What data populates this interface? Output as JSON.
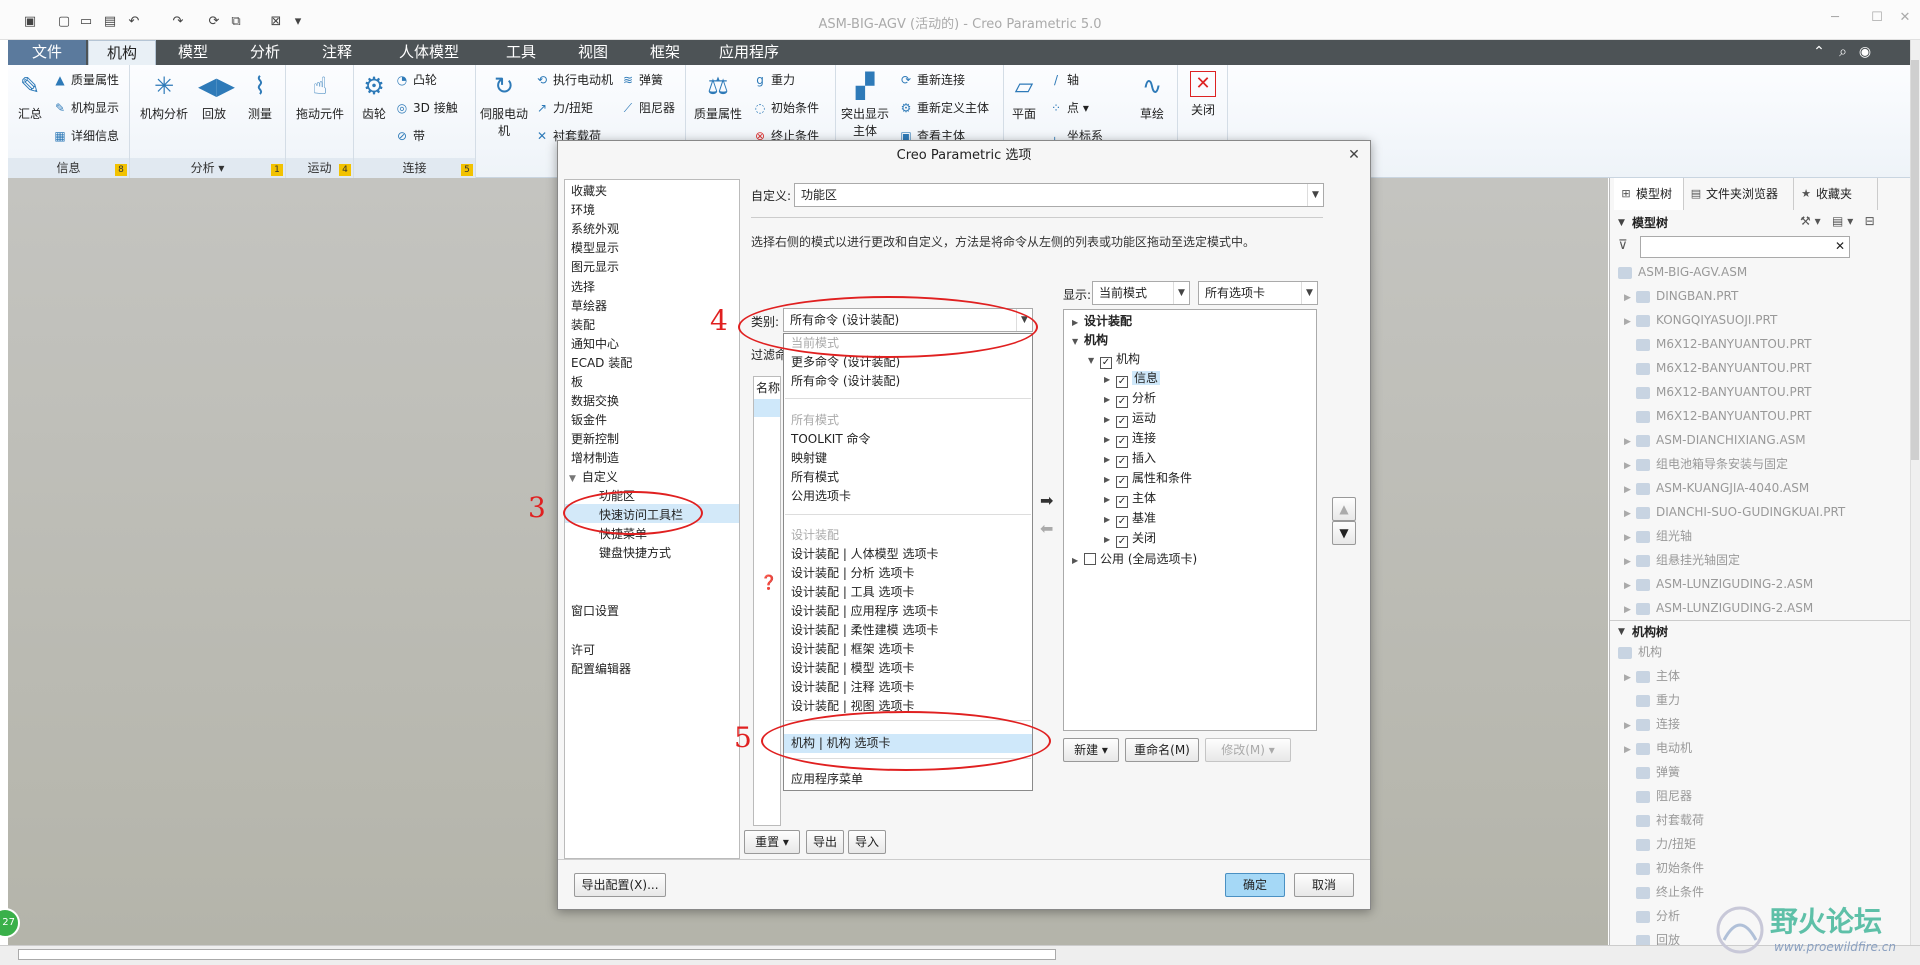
{
  "window": {
    "title": "ASM-BIG-AGV (活动的) - Creo Parametric 5.0"
  },
  "ribbon_tabs": [
    "文件",
    "机构",
    "模型",
    "分析",
    "注释",
    "人体模型",
    "工具",
    "视图",
    "框架",
    "应用程序"
  ],
  "ribbon": {
    "info_group": {
      "label": "信息",
      "num": "8",
      "buttons": {
        "summary": "汇总",
        "mass": "质量属性",
        "mech_display": "机构显示",
        "details": "详细信息"
      }
    },
    "analysis_group": {
      "label": "分析",
      "num": "1",
      "buttons": {
        "mech_analysis": "机构分析",
        "playback": "回放",
        "measure": "测量"
      }
    },
    "motion_group": {
      "label": "运动",
      "num": "4",
      "buttons": {
        "drag": "拖动元件"
      }
    },
    "connect_group": {
      "label": "连接",
      "num": "5",
      "buttons": {
        "gear": "齿轮",
        "cam": "凸轮",
        "slot3d": "3D 接触",
        "belt": "带"
      }
    },
    "insert_buttons": {
      "servo": "伺服电动机",
      "exec_motor": "执行电动机",
      "force": "力/扭矩",
      "bushing": "衬套载荷",
      "spring": "弹簧",
      "damper": "阻尼器"
    },
    "props_buttons": {
      "mass_props": "质量属性",
      "gravity": "重力",
      "init_cond": "初始条件",
      "term_cond": "终止条件"
    },
    "body_buttons": {
      "highlight": "突出显示主体",
      "reconnect": "重新连接",
      "redefine": "重新定义主体",
      "view_body": "查看主体"
    },
    "datum_buttons": {
      "plane": "平面",
      "axis": "轴",
      "point": "点",
      "csys": "坐标系",
      "sketch": "草绘"
    },
    "close": "关闭"
  },
  "side_panel": {
    "tabs": [
      "模型树",
      "文件夹浏览器",
      "收藏夹"
    ],
    "model_tree_header": "模型树",
    "tree_items": [
      "ASM-BIG-AGV.ASM",
      "DINGBAN.PRT",
      "KONGQIYASUOJI.PRT",
      "M6X12-BANYUANTOU.PRT",
      "M6X12-BANYUANTOU.PRT",
      "M6X12-BANYUANTOU.PRT",
      "M6X12-BANYUANTOU.PRT",
      "ASM-DIANCHIXIANG.ASM",
      "组电池箱导条安装与固定",
      "ASM-KUANGJIA-4040.ASM",
      "DIANCHI-SUO-GUDINGKUAI.PRT",
      "组光轴",
      "组悬挂光轴固定",
      "ASM-LUNZIGUDING-2.ASM",
      "ASM-LUNZIGUDING-2.ASM"
    ],
    "mech_tree_header": "机构树",
    "mech_items": [
      "机构",
      "主体",
      "重力",
      "连接",
      "电动机",
      "弹簧",
      "阻尼器",
      "衬套载荷",
      "力/扭矩",
      "初始条件",
      "终止条件",
      "分析",
      "回放"
    ]
  },
  "status_bubble": "27",
  "watermark": {
    "title": "野火论坛",
    "url": "www.proewildfire.cn"
  },
  "dialog": {
    "title": "Creo Parametric 选项",
    "nav": [
      "收藏夹",
      "环境",
      "系统外观",
      "模型显示",
      "图元显示",
      "选择",
      "草绘器",
      "装配",
      "通知中心",
      "ECAD 装配",
      "板",
      "数据交换",
      "钣金件",
      "更新控制",
      "增材制造"
    ],
    "nav_customize": "自定义",
    "nav_sub": [
      "功能区",
      "快速访问工具栏",
      "快捷菜单",
      "键盘快捷方式"
    ],
    "nav_window": "窗口设置",
    "nav_tail": [
      "许可",
      "配置编辑器"
    ],
    "customize_label": "自定义:",
    "customize_value": "功能区",
    "description": "选择右侧的模式以进行更改和自定义，方法是将命令从左侧的列表或功能区拖动至选定模式中。",
    "category_label": "类别:",
    "category_value": "所有命令 (设计装配)",
    "filter_label": "过滤命",
    "name_col": "名称",
    "show_label": "显示:",
    "show_mode": "当前模式",
    "show_tabs": "所有选项卡",
    "dropdown": {
      "g1_header": "当前模式",
      "g1": [
        "更多命令 (设计装配)",
        "所有命令 (设计装配)"
      ],
      "g2_header": "所有模式",
      "g2": [
        "TOOLKIT 命令",
        "映射键",
        "所有模式",
        "公用选项卡"
      ],
      "g3_header": "设计装配",
      "g3": [
        "设计装配 | 人体模型 选项卡",
        "设计装配 | 分析 选项卡",
        "设计装配 | 工具 选项卡",
        "设计装配 | 应用程序 选项卡",
        "设计装配 | 柔性建模 选项卡",
        "设计装配 | 框架 选项卡",
        "设计装配 | 模型 选项卡",
        "设计装配 | 注释 选项卡",
        "设计装配 | 视图 选项卡"
      ],
      "selected": "机构 | 机构 选项卡",
      "last": "应用程序菜单"
    },
    "tree": {
      "design_asm": "设计装配",
      "mech_root": "机构",
      "mech_tab": "机构",
      "groups": [
        "信息",
        "分析",
        "运动",
        "连接",
        "插入",
        "属性和条件",
        "主体",
        "基准",
        "关闭"
      ],
      "common": "公用 (全局选项卡)"
    },
    "buttons": {
      "new": "新建",
      "rename": "重命名(M)",
      "modify": "修改(M)",
      "reset": "重置",
      "export": "导出",
      "import": "导入",
      "export_config": "导出配置(X)...",
      "ok": "确定",
      "cancel": "取消"
    }
  },
  "annotations": [
    "3",
    "4",
    "5"
  ],
  "colors": {
    "ribbon_tab_bar": "#4d5356",
    "file_tab": "#5b7a9d",
    "selection": "#cfe8fa",
    "primary_button": "#a5d8f6",
    "annotation_red": "#e02020"
  }
}
